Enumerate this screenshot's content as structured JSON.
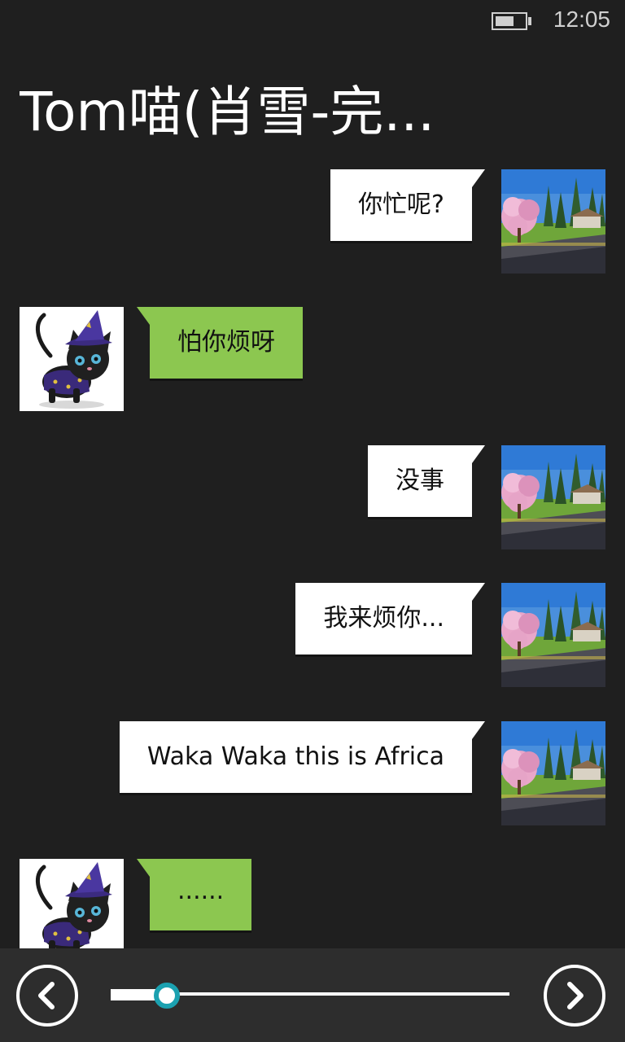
{
  "status_bar": {
    "time": "12:05",
    "battery_level": 0.6
  },
  "header": {
    "title": "Tom喵(肖雪-完..."
  },
  "messages": [
    {
      "sender": "me",
      "text": "你忙呢?",
      "avatar": "landscape-avatar"
    },
    {
      "sender": "them",
      "text": "怕你烦呀",
      "avatar": "black-cat-wizard-avatar"
    },
    {
      "sender": "me",
      "text": "没事",
      "avatar": "landscape-avatar"
    },
    {
      "sender": "me",
      "text": "我来烦你...",
      "avatar": "landscape-avatar"
    },
    {
      "sender": "me",
      "text": "Waka Waka this is Africa",
      "avatar": "landscape-avatar"
    },
    {
      "sender": "them",
      "text": "......",
      "avatar": "black-cat-wizard-avatar"
    }
  ],
  "app_bar": {
    "prev_icon": "chevron-left-icon",
    "next_icon": "chevron-right-icon",
    "slider_value": 0.14,
    "thumb_color": "#1ba1b0"
  },
  "colors": {
    "background": "#1f1f1f",
    "my_bubble": "#ffffff",
    "their_bubble": "#8cc750",
    "app_bar": "#2d2d2d"
  }
}
